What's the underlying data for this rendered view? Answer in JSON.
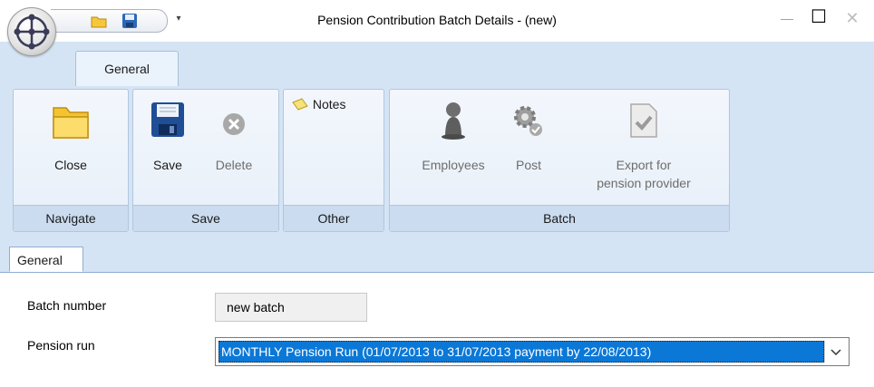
{
  "window": {
    "title": "Pension Contribution Batch Details - (new)",
    "controls": {
      "minimize": "—",
      "maximize": "☐",
      "close": "✕"
    }
  },
  "quick_access": {
    "customize_glyph": "▾"
  },
  "ribbon": {
    "active_tab": "General",
    "groups": {
      "navigate": {
        "label": "Navigate",
        "close_label": "Close"
      },
      "save": {
        "label": "Save",
        "save_label": "Save",
        "delete_label": "Delete"
      },
      "other": {
        "label": "Other",
        "notes_label": "Notes"
      },
      "batch": {
        "label": "Batch",
        "employees_label": "Employees",
        "post_label": "Post",
        "export_label_line1": "Export for",
        "export_label_line2": "pension provider"
      }
    }
  },
  "document_tab": {
    "label": "General"
  },
  "form": {
    "batch_number_label": "Batch number",
    "batch_number_value": "new batch",
    "pension_run_label": "Pension run",
    "pension_run_value": "MONTHLY Pension Run  (01/07/2013 to 31/07/2013  payment by 22/08/2013)"
  },
  "colors": {
    "ribbon_bg": "#d5e4f4",
    "selection": "#0b78d7",
    "disabled_text": "#6d6d6d"
  }
}
